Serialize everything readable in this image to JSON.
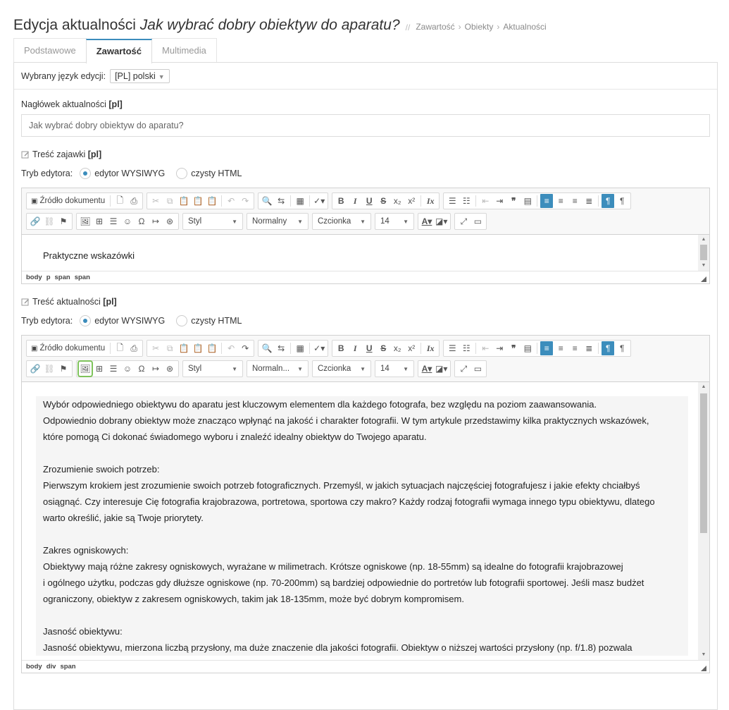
{
  "header": {
    "title_prefix": "Edycja aktualności ",
    "title_item": "Jak wybrać dobry obiektyw do aparatu?",
    "separator": "//",
    "breadcrumb": [
      "Zawartość",
      "Obiekty",
      "Aktualności"
    ]
  },
  "tabs": [
    {
      "label": "Podstawowe",
      "active": false
    },
    {
      "label": "Zawartość",
      "active": true
    },
    {
      "label": "Multimedia",
      "active": false
    }
  ],
  "language": {
    "label": "Wybrany język edycji:",
    "value": "[PL] polski"
  },
  "headline": {
    "label": "Nagłówek aktualności",
    "lang": "[pl]",
    "value": "Jak wybrać dobry obiektyw do aparatu?"
  },
  "editor_mode": {
    "label": "Tryb edytora:",
    "wysiwyg": "edytor WYSIWYG",
    "html": "czysty HTML"
  },
  "toolbar": {
    "source_label": "Źródło dokumentu",
    "style": "Styl",
    "format1": "Normalny",
    "format2": "Normaln...",
    "font": "Czcionka",
    "size": "14"
  },
  "teaser": {
    "label": "Treść zajawki",
    "lang": "[pl]",
    "content": "Praktyczne wskazówki",
    "path": [
      "body",
      "p",
      "span",
      "span"
    ]
  },
  "body": {
    "label": "Treść aktualności",
    "lang": "[pl]",
    "path": [
      "body",
      "div",
      "span"
    ],
    "paragraphs": [
      "Wybór odpowiedniego obiektywu do aparatu jest kluczowym elementem dla każdego fotografa, bez względu na poziom zaawansowania.",
      "Odpowiednio dobrany obiektyw może znacząco wpłynąć na jakość i charakter fotografii. W tym artykule przedstawimy kilka praktycznych wskazówek,",
      "które pomogą Ci dokonać świadomego wyboru i znaleźć idealny obiektyw do Twojego aparatu.",
      "",
      "Zrozumienie swoich potrzeb:",
      "Pierwszym krokiem jest zrozumienie swoich potrzeb fotograficznych. Przemyśl, w jakich sytuacjach najczęściej fotografujesz i jakie efekty chciałbyś",
      "osiągnąć. Czy interesuje Cię fotografia krajobrazowa, portretowa, sportowa czy makro? Każdy rodzaj fotografii wymaga innego typu obiektywu, dlatego",
      "warto określić, jakie są Twoje priorytety.",
      "",
      "Zakres ogniskowych:",
      "Obiektywy mają różne zakresy ogniskowych, wyrażane w milimetrach. Krótsze ogniskowe (np. 18-55mm) są idealne do fotografii krajobrazowej",
      "i ogólnego użytku, podczas gdy dłuższe ogniskowe (np. 70-200mm) są bardziej odpowiednie do portretów lub fotografii sportowej. Jeśli masz budżet",
      "ograniczony, obiektyw z zakresem ogniskowych, takim jak 18-135mm, może być dobrym kompromisem.",
      "",
      "Jasność obiektywu:",
      "Jasność obiektywu, mierzona liczbą przysłony, ma duże znaczenie dla jakości fotografii. Obiektyw o niższej wartości przysłony (np. f/1.8) pozwala"
    ]
  },
  "colors": {
    "accent": "#3c8dbc",
    "highlight": "#7ec35b"
  }
}
